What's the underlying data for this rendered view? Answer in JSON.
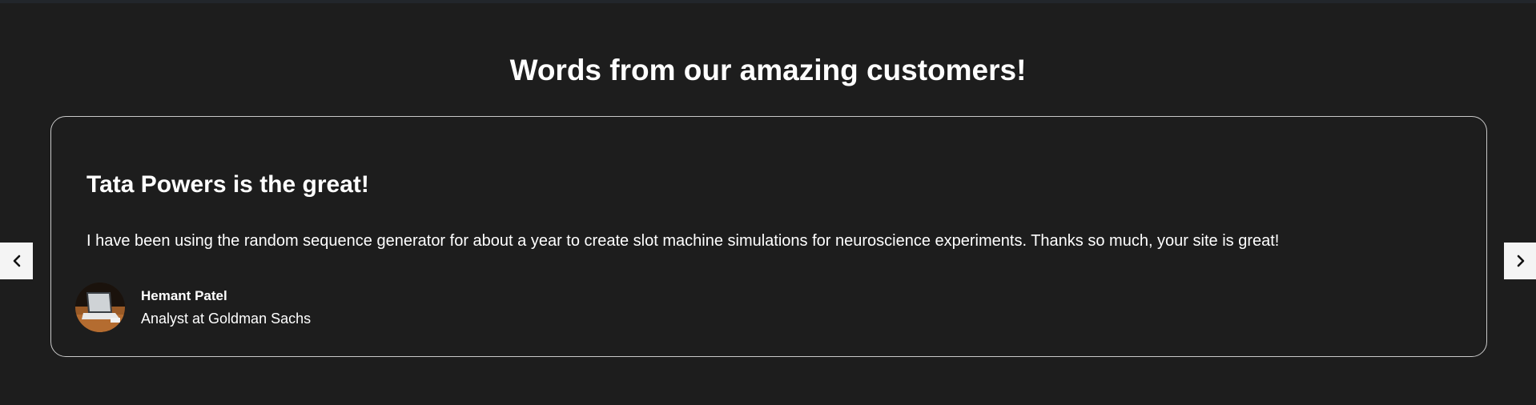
{
  "section": {
    "title": "Words from our amazing customers!"
  },
  "testimonial": {
    "heading": "Tata Powers is the great!",
    "quote": "I have been using the random sequence generator for about a year to create slot machine simulations for neuroscience experiments. Thanks so much, your site is great!",
    "author_name": "Hemant Patel",
    "author_role": "Analyst at Goldman Sachs",
    "avatar_icon": "laptop-photo"
  },
  "carousel": {
    "prev_icon": "chevron-left-icon",
    "next_icon": "chevron-right-icon"
  },
  "colors": {
    "background": "#1d1d1d",
    "card_border": "#c9c9c9",
    "text": "#ffffff",
    "nav_button": "#f4f4f4"
  }
}
